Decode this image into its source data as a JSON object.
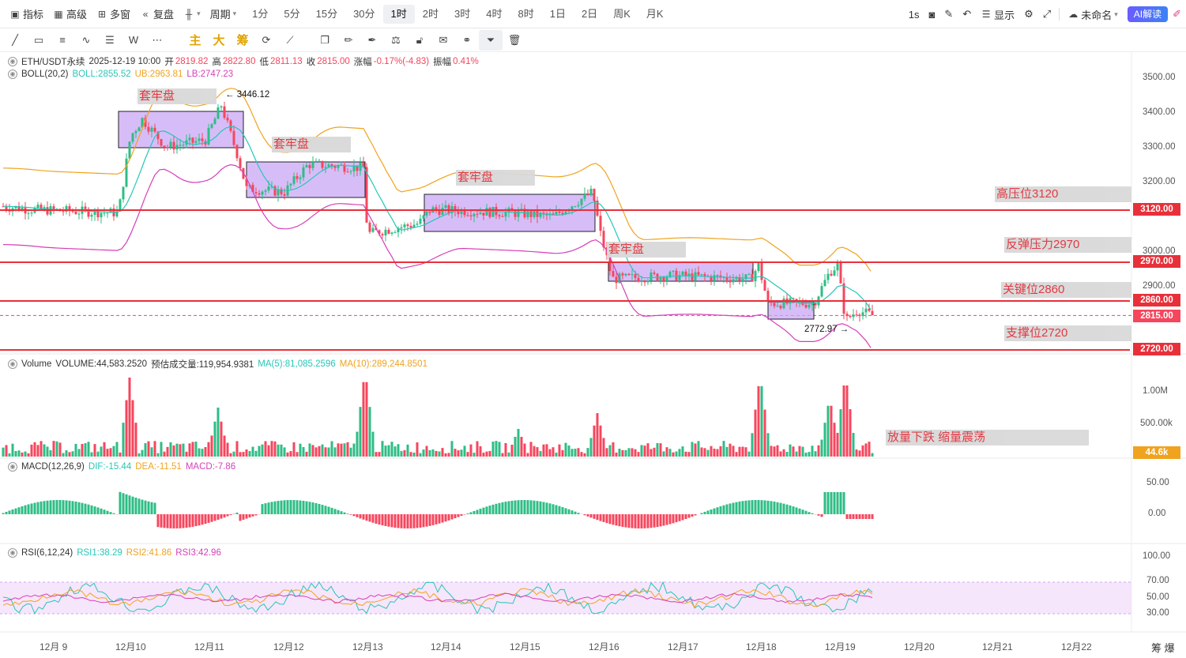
{
  "topbar": {
    "indicators": "指标",
    "advanced": "高级",
    "multi_window": "多窗",
    "replay": "复盘",
    "period": "周期",
    "timeframes": [
      "1分",
      "5分",
      "15分",
      "30分",
      "1时",
      "2时",
      "3时",
      "4时",
      "8时",
      "1日",
      "2日",
      "周K",
      "月K"
    ],
    "active_timeframe": "1时",
    "seconds": "1s",
    "display": "显示",
    "layout_name": "未命名",
    "ai_button": "AI解读"
  },
  "drawbar": {
    "cn_tools": [
      "主",
      "大",
      "筹"
    ]
  },
  "legend": {
    "symbol": "ETH/USDT永续",
    "datetime": "2025-12-19 10:00",
    "open_label": "开",
    "open": "2819.82",
    "high_label": "高",
    "high": "2822.80",
    "low_label": "低",
    "low": "2811.13",
    "close_label": "收",
    "close": "2815.00",
    "change_label": "涨幅",
    "change": "-0.17%(-4.83)",
    "amp_label": "振幅",
    "amp": "0.41%",
    "boll_name": "BOLL(20,2)",
    "boll_mid": "BOLL:2855.52",
    "boll_ub": "UB:2963.81",
    "boll_lb": "LB:2747.23",
    "vol_name": "Volume",
    "vol_value": "VOLUME:44,583.2520",
    "vol_est": "预估成交量:119,954.9381",
    "vol_ma5": "MA(5):81,085.2596",
    "vol_ma10": "MA(10):289,244.8501",
    "macd_name": "MACD(12,26,9)",
    "macd_dif": "DIF:-15.44",
    "macd_dea": "DEA:-11.51",
    "macd_val": "MACD:-7.86",
    "rsi_name": "RSI(6,12,24)",
    "rsi1": "RSI1:38.29",
    "rsi2": "RSI2:41.86",
    "rsi3": "RSI3:42.96"
  },
  "price_axis": [
    "3500.00",
    "3400.00",
    "3300.00",
    "3200.00",
    "3000.00",
    "2900.00"
  ],
  "price_tags": {
    "p3120": "3120.00",
    "p2970": "2970.00",
    "p2860": "2860.00",
    "p2815": "2815.00",
    "p2720": "2720.00"
  },
  "volume_axis": {
    "v1m": "1.00M",
    "v500k": "500.00k",
    "vcur": "44.6k"
  },
  "macd_axis": {
    "m50": "50.00",
    "m0": "0.00"
  },
  "rsi_axis": {
    "r100": "100.00",
    "r70": "70.00",
    "r50": "50.00",
    "r30": "30.00"
  },
  "annotations": {
    "trap1": "套牢盘",
    "trap2": "套牢盘",
    "trap3": "套牢盘",
    "trap4": "套牢盘",
    "resist_high": "高压位3120",
    "rebound": "反弹压力2970",
    "key": "关键位2860",
    "support": "支撑位2720",
    "volume_note": "放量下跌 缩量震荡",
    "high_mark": "3446.12",
    "low_mark": "2772.97"
  },
  "dates": [
    "12月 9",
    "12月10",
    "12月11",
    "12月12",
    "12月13",
    "12月14",
    "12月15",
    "12月16",
    "12月17",
    "12月18",
    "12月19",
    "12月20",
    "12月21",
    "12月22"
  ],
  "corner": "筹 爆",
  "colors": {
    "up": "#2ebd85",
    "down": "#f6465d",
    "line": "#e8303a",
    "ma_yellow": "#f0a31f",
    "ma_teal": "#26c6b8",
    "ma_pink": "#d63fb8",
    "box": "#c9a7f5"
  }
}
